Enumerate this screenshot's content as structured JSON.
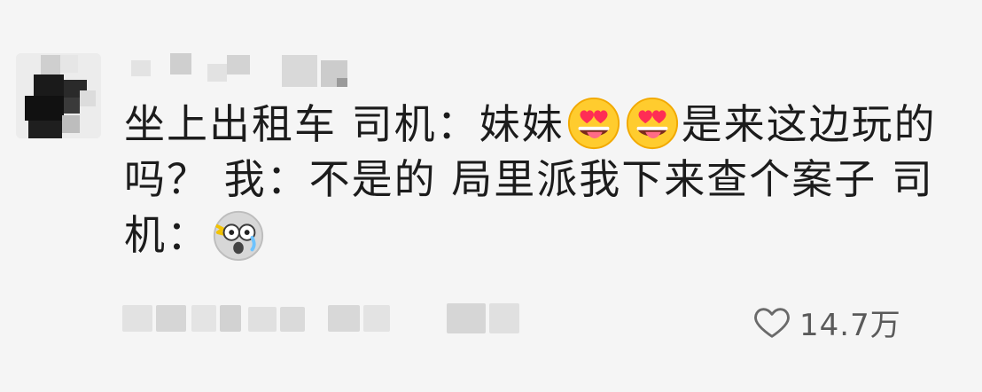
{
  "comment": {
    "avatar_icon": "avatar-censored",
    "text_line_1_a": "坐上出租车 司机：妹妹",
    "text_line_1_b": "是来这边玩的",
    "text_line_2": "吗？ 我：不是的 局里派我下来查个案子 司",
    "text_line_3": "机：",
    "emoji_1": "heart-eyes-tongue-icon",
    "emoji_2": "heart-eyes-tongue-icon",
    "emoji_3": "shocked-face-icon"
  },
  "footer": {
    "like_icon": "heart-outline-icon",
    "like_count": "14.7万"
  }
}
